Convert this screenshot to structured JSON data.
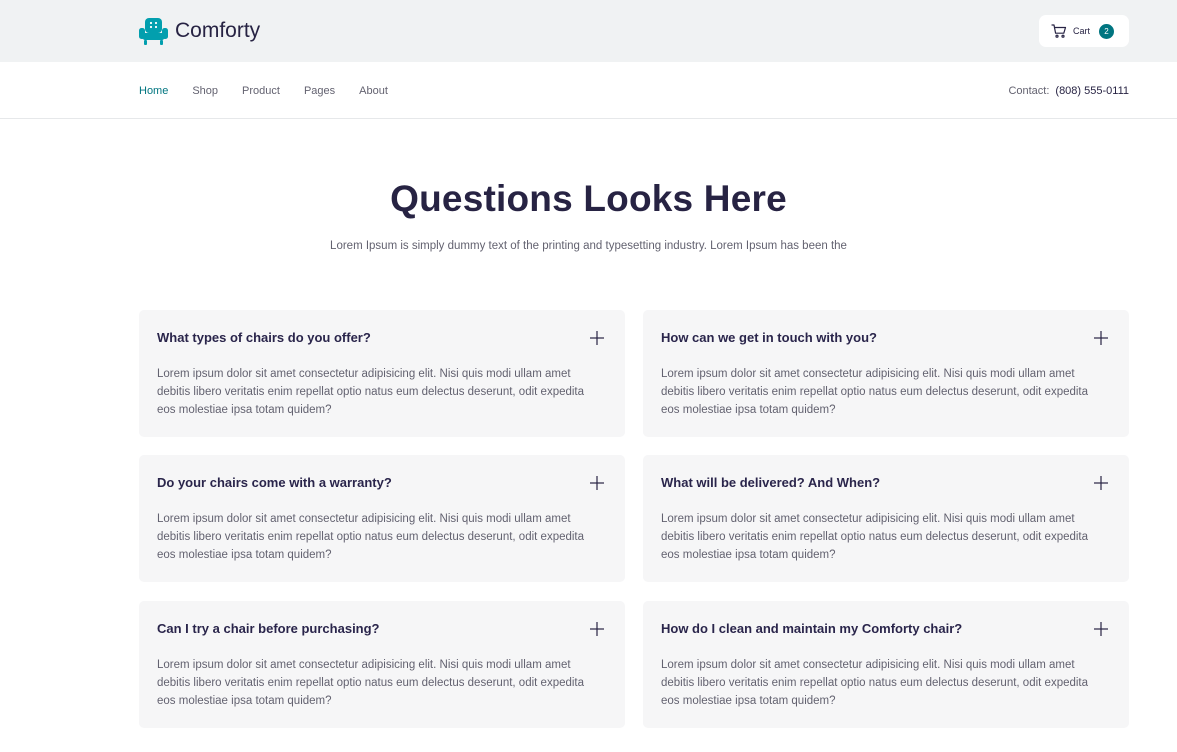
{
  "brand": {
    "name": "Comforty",
    "accent": "#007580"
  },
  "cart": {
    "label": "Cart",
    "count": "2"
  },
  "nav": {
    "items": [
      {
        "label": "Home",
        "active": true
      },
      {
        "label": "Shop"
      },
      {
        "label": "Product"
      },
      {
        "label": "Pages"
      },
      {
        "label": "About"
      }
    ],
    "contact_label": "Contact:",
    "contact_phone": "(808) 555-0111"
  },
  "hero": {
    "title": "Questions Looks Here",
    "subtitle": "Lorem Ipsum is simply dummy text of the printing and typesetting industry. Lorem Ipsum has been the"
  },
  "faq": [
    {
      "question": "What types of chairs do you offer?",
      "answer": "Lorem ipsum dolor sit amet consectetur adipisicing elit. Nisi quis modi ullam amet debitis libero veritatis enim repellat optio natus eum delectus deserunt, odit expedita eos molestiae ipsa totam quidem?"
    },
    {
      "question": "How can we get in touch with you?",
      "answer": "Lorem ipsum dolor sit amet consectetur adipisicing elit. Nisi quis modi ullam amet debitis libero veritatis enim repellat optio natus eum delectus deserunt, odit expedita eos molestiae ipsa totam quidem?"
    },
    {
      "question": "Do your chairs come with a warranty?",
      "answer": "Lorem ipsum dolor sit amet consectetur adipisicing elit. Nisi quis modi ullam amet debitis libero veritatis enim repellat optio natus eum delectus deserunt, odit expedita eos molestiae ipsa totam quidem?"
    },
    {
      "question": "What will be delivered? And When?",
      "answer": "Lorem ipsum dolor sit amet consectetur adipisicing elit. Nisi quis modi ullam amet debitis libero veritatis enim repellat optio natus eum delectus deserunt, odit expedita eos molestiae ipsa totam quidem?"
    },
    {
      "question": "Can I try a chair before purchasing?",
      "answer": "Lorem ipsum dolor sit amet consectetur adipisicing elit. Nisi quis modi ullam amet debitis libero veritatis enim repellat optio natus eum delectus deserunt, odit expedita eos molestiae ipsa totam quidem?"
    },
    {
      "question": "How do I clean and maintain my Comforty chair?",
      "answer": "Lorem ipsum dolor sit amet consectetur adipisicing elit. Nisi quis modi ullam amet debitis libero veritatis enim repellat optio natus eum delectus deserunt, odit expedita eos molestiae ipsa totam quidem?"
    }
  ],
  "icons": {
    "logo": "armchair-icon",
    "cart": "cart-icon",
    "toggle": "plus-icon"
  }
}
